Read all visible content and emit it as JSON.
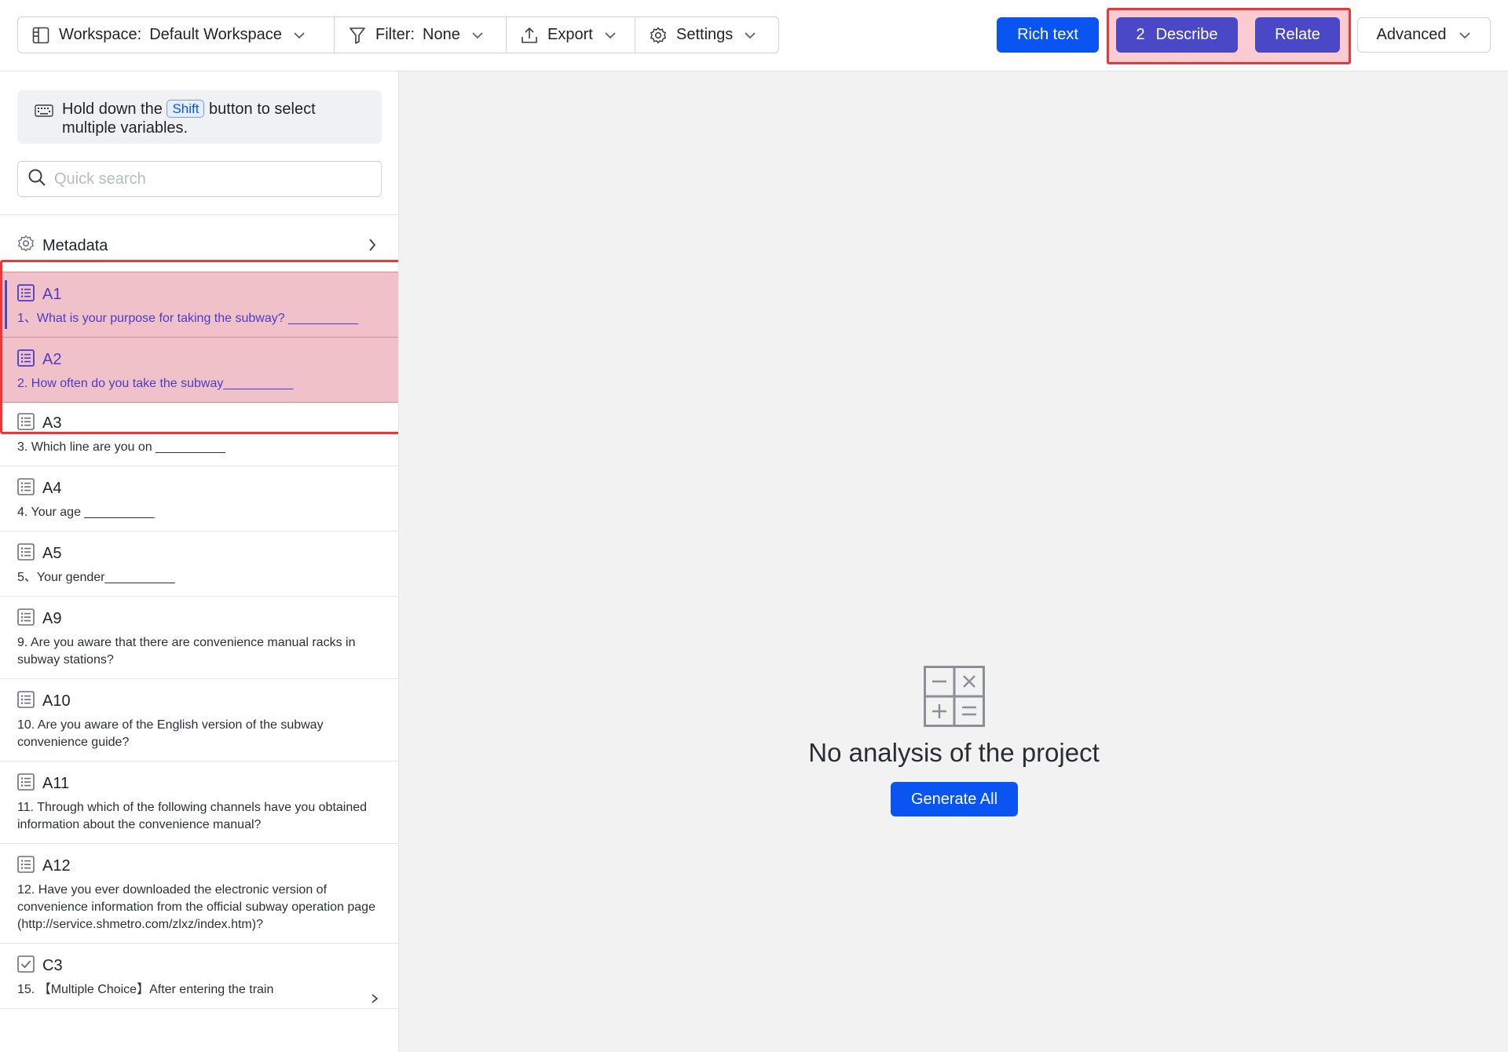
{
  "toolbar": {
    "workspace_label": "Workspace:",
    "workspace_value": "Default Workspace",
    "filter_label": "Filter:",
    "filter_value": "None",
    "export_label": "Export",
    "settings_label": "Settings",
    "rich_text_label": "Rich text",
    "describe_count": "2",
    "describe_label": "Describe",
    "relate_label": "Relate",
    "advanced_label": "Advanced"
  },
  "sidebar": {
    "hint_prefix": "Hold down the",
    "hint_key": "Shift",
    "hint_suffix": "button to select multiple variables.",
    "search_placeholder": "Quick search",
    "metadata_label": "Metadata",
    "variables": [
      {
        "code": "A1",
        "desc": "1、What is your purpose for taking the subway? __________",
        "icon": "list-icon",
        "selected": true
      },
      {
        "code": "A2",
        "desc": "2. How often do you take the subway__________",
        "icon": "list-icon",
        "selected": true
      },
      {
        "code": "A3",
        "desc": "3. Which line are you on __________",
        "icon": "list-icon",
        "selected": false
      },
      {
        "code": "A4",
        "desc": "4. Your age __________",
        "icon": "list-icon",
        "selected": false
      },
      {
        "code": "A5",
        "desc": "5、Your gender__________",
        "icon": "list-icon",
        "selected": false
      },
      {
        "code": "A9",
        "desc": "9. Are you aware that there are convenience manual racks in subway stations?",
        "icon": "list-icon",
        "selected": false
      },
      {
        "code": "A10",
        "desc": "10. Are you aware of the English version of the subway convenience guide?",
        "icon": "list-icon",
        "selected": false
      },
      {
        "code": "A11",
        "desc": "11. Through which of the following channels have you obtained information about the convenience manual?",
        "icon": "list-icon",
        "selected": false
      },
      {
        "code": "A12",
        "desc": "12. Have you ever downloaded the electronic version of convenience information from the official subway operation page (http://service.shmetro.com/zlxz/index.htm)?",
        "icon": "list-icon",
        "selected": false
      },
      {
        "code": "C3",
        "desc": "15. 【Multiple Choice】After entering the train",
        "icon": "checkbox-icon",
        "selected": false
      }
    ]
  },
  "main": {
    "empty_title": "No analysis of the project",
    "generate_label": "Generate All"
  },
  "colors": {
    "primary": "#0a55f2",
    "accent": "#4b48c8",
    "highlight": "#ee3636"
  }
}
